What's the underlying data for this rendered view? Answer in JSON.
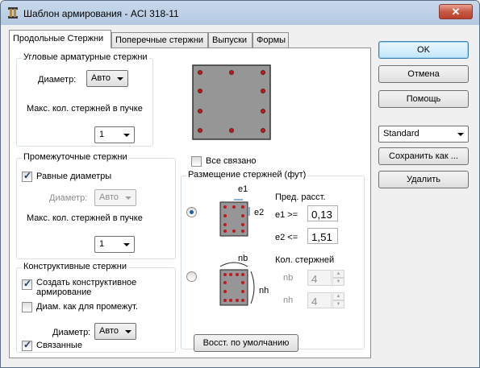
{
  "window": {
    "title": "Шаблон армирования - ACI 318-11",
    "close_label": "✕"
  },
  "tabs": [
    "Продольные Стержни",
    "Поперечные стержни",
    "Выпуски",
    "Формы"
  ],
  "corner_group": {
    "title": "Угловые арматурные стержни",
    "diameter_label": "Диаметр:",
    "diameter_value": "Авто",
    "max_label": "Макс. кол. стержней в пучке",
    "max_value": "1"
  },
  "all_linked_label": "Все связано",
  "intermediate_group": {
    "title": "Промежуточные стержни",
    "equal_diameters_label": "Равные диаметры",
    "equal_diameters_checked": true,
    "diameter_label": "Диаметр:",
    "diameter_value": "Авто",
    "max_label": "Макс. кол. стержней в пучке",
    "max_value": "1"
  },
  "structural_group": {
    "title": "Конструктивные стержни",
    "create_label_line1": "Создать конструктивное",
    "create_label_line2": "армирование",
    "create_checked": true,
    "diam_as_intermediate_label": "Диам. как для промежут.",
    "diam_as_intermediate_checked": false,
    "diameter_label": "Диаметр:",
    "diameter_value": "Авто",
    "linked_label": "Связанные",
    "linked_checked": true
  },
  "placement_group": {
    "title": "Размещение стержней (фут)",
    "limit_header": "Пред. расст.",
    "e1_label": "e1 >=",
    "e1_value": "0,13",
    "e2_label": "e2 <=",
    "e2_value": "1,51",
    "count_header": "Кол. стержней",
    "nb_label": "nb",
    "nb_value": "4",
    "nh_label": "nh",
    "nh_value": "4",
    "diagram1_e1": "e1",
    "diagram1_e2": "e2",
    "diagram2_nb": "nb",
    "diagram2_nh": "nh"
  },
  "restore_defaults_label": "Восст. по умолчанию",
  "side_buttons": {
    "ok": "OK",
    "cancel": "Отмена",
    "help": "Помощь"
  },
  "preset": {
    "value": "Standard",
    "save_as": "Сохранить как ...",
    "delete": "Удалить"
  },
  "colors": {
    "section_fill": "#969696",
    "rebar_dot": "#c0181e"
  }
}
